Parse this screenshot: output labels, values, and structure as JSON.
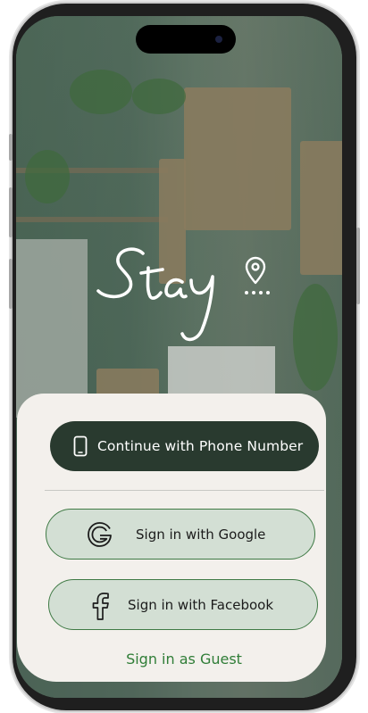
{
  "app": {
    "name": "Stay"
  },
  "buttons": {
    "phone_label": "Continue with Phone Number",
    "google_label": "Sign in with Google",
    "facebook_label": "Sign in with Facebook",
    "guest_label": "Sign in as Guest"
  },
  "icons": {
    "phone": "phone-icon",
    "google": "google-icon",
    "facebook": "facebook-icon",
    "logo_pin": "location-pin-icon"
  },
  "colors": {
    "primary_button": "#293a2f",
    "secondary_button_bg": "#d3dfd4",
    "secondary_button_border": "#3f7a45",
    "guest_link": "#2f7d37",
    "panel_bg": "#f3f0ec"
  }
}
